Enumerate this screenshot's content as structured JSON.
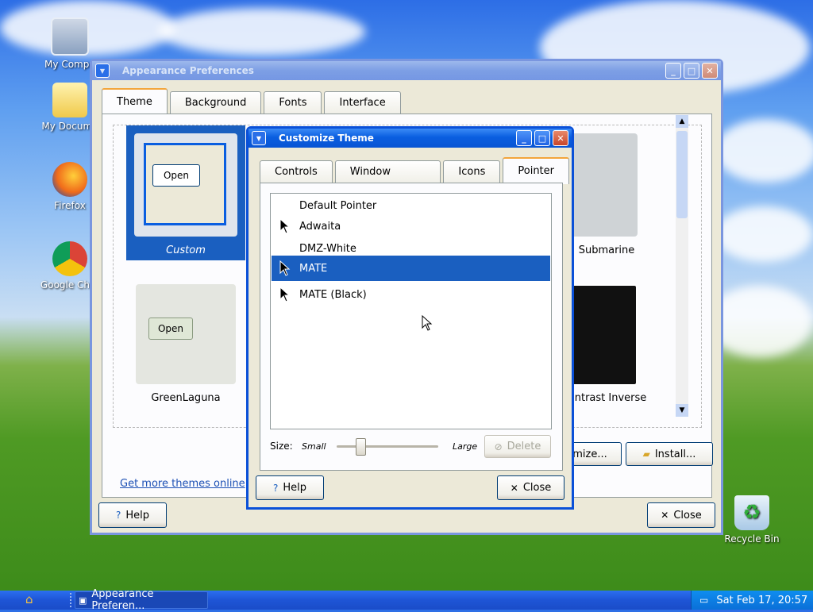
{
  "desktop": {
    "icons": [
      {
        "label": "My Compu"
      },
      {
        "label": "My Docume"
      },
      {
        "label": "Firefox"
      },
      {
        "label": "Google Chro"
      },
      {
        "label": "Recycle Bin"
      }
    ]
  },
  "appearance": {
    "title": "Appearance Preferences",
    "tabs": [
      "Theme",
      "Background",
      "Fonts",
      "Interface"
    ],
    "themes": [
      {
        "name": "Custom"
      },
      {
        "name": "Submarine"
      },
      {
        "name": "GreenLaguna"
      },
      {
        "name": "ntrast Inverse"
      }
    ],
    "thumb_open": "Open",
    "customize_label": "mize...",
    "install_label": "Install...",
    "more_themes_link": "Get more themes online",
    "help_label": "Help",
    "close_label": "Close"
  },
  "customize": {
    "title": "Customize Theme",
    "tabs": [
      "Controls",
      "Window Border",
      "Icons",
      "Pointer"
    ],
    "pointers": [
      {
        "name": "Default Pointer",
        "has_icon": false
      },
      {
        "name": "Adwaita",
        "has_icon": true
      },
      {
        "name": "DMZ-White",
        "has_icon": false
      },
      {
        "name": "MATE",
        "has_icon": true,
        "selected": true
      },
      {
        "name": "MATE (Black)",
        "has_icon": true
      }
    ],
    "size_label": "Size:",
    "size_small": "Small",
    "size_large": "Large",
    "size_value": 0.23,
    "delete_label": "Delete",
    "help_label": "Help",
    "close_label": "Close"
  },
  "taskbar": {
    "task_label": "Appearance Preferen...",
    "clock": "Sat Feb 17, 20:57"
  },
  "colors": {
    "title_active": "#0a5ee0",
    "selection": "#1a5fc0",
    "taskbar": "#1e55d6",
    "tab_highlight": "#f3a53b"
  }
}
